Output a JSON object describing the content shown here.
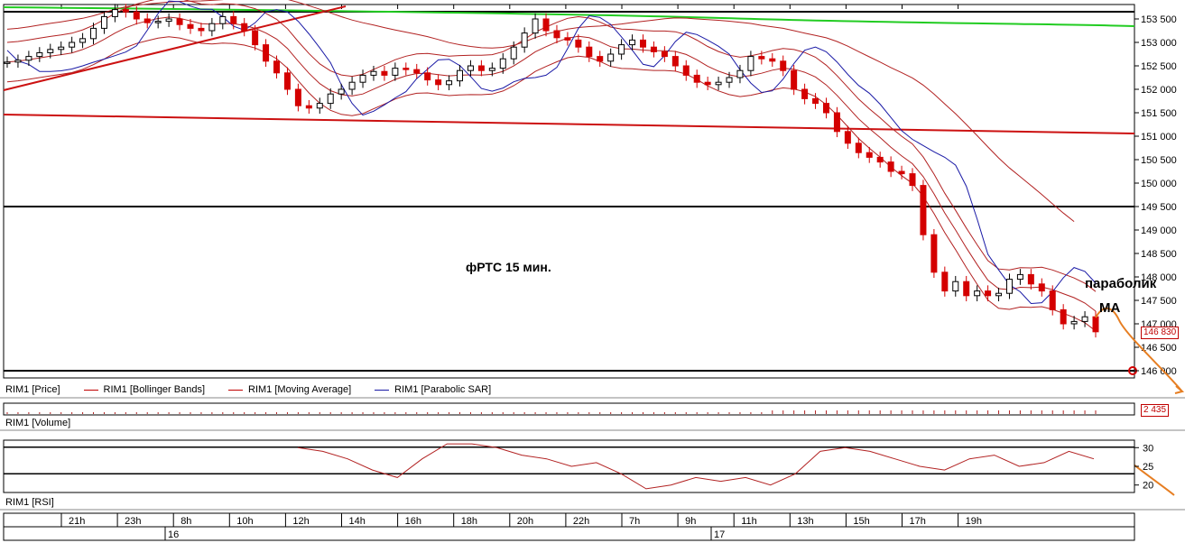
{
  "chart_data": {
    "type": "candlestick",
    "title": "фРТС   15 мин.",
    "ylim": [
      146000,
      153750
    ],
    "y_ticks": [
      "153 500",
      "153 000",
      "152 500",
      "152 000",
      "151 500",
      "151 000",
      "150 500",
      "150 000",
      "149 500",
      "149 000",
      "148 500",
      "148 000",
      "147 500",
      "147 000",
      "146 500",
      "146 000"
    ],
    "y_tick_values": [
      153500,
      153000,
      152500,
      152000,
      151500,
      151000,
      150500,
      150000,
      149500,
      149000,
      148500,
      148000,
      147500,
      147000,
      146500,
      146000
    ],
    "last_price": "146 830",
    "time_labels": [
      "21h",
      "23h",
      "8h",
      "10h",
      "12h",
      "14h",
      "16h",
      "18h",
      "20h",
      "22h",
      "7h",
      "9h",
      "11h",
      "13h",
      "15h",
      "17h",
      "19h"
    ],
    "date_labels": [
      "16",
      "17"
    ],
    "legend": [
      {
        "label": "RIM1 [Price]",
        "swatch": false
      },
      {
        "label": "RIM1 [Bollinger Bands]",
        "swatch": "bb"
      },
      {
        "label": "RIM1 [Moving Average]",
        "swatch": "ma"
      },
      {
        "label": "RIM1 [Parabolic SAR]",
        "swatch": "sar"
      }
    ],
    "volume_label": "RIM1 [Volume]",
    "volume_last": "2 435",
    "rsi_label": "RIM1 [RSI]",
    "rsi_ticks": [
      "30",
      "25",
      "20"
    ],
    "rsi_tick_values": [
      30,
      25,
      20
    ],
    "rsi_ylim": [
      18,
      32
    ],
    "annotations": [
      "параболик",
      "МА"
    ],
    "horizontal_levels": [
      153750,
      149500,
      146000
    ],
    "close_path": [
      152580,
      152620,
      152700,
      152780,
      152850,
      152900,
      153000,
      153080,
      153300,
      153550,
      153700,
      153650,
      153500,
      153420,
      153450,
      153500,
      153380,
      153300,
      153250,
      153400,
      153550,
      153400,
      153250,
      152950,
      152600,
      152350,
      152000,
      151650,
      151600,
      151700,
      151900,
      152000,
      152150,
      152300,
      152380,
      152300,
      152450,
      152420,
      152350,
      152200,
      152100,
      152180,
      152400,
      152500,
      152400,
      152450,
      152650,
      152900,
      153200,
      153500,
      153250,
      153100,
      153050,
      152900,
      152700,
      152600,
      152750,
      152950,
      153050,
      152900,
      152800,
      152700,
      152500,
      152300,
      152150,
      152100,
      152150,
      152250,
      152400,
      152700,
      152650,
      152600,
      152400,
      152000,
      151800,
      151700,
      151500,
      151100,
      150850,
      150650,
      150550,
      150450,
      150250,
      150200,
      149950,
      148900,
      148100,
      147700,
      147900,
      147600,
      147700,
      147600,
      147650,
      147950,
      148050,
      147850,
      147700,
      147300,
      147000,
      147050,
      147150,
      146830
    ],
    "rsi_path": [
      30,
      29,
      27,
      24,
      22,
      27,
      31,
      31,
      30,
      28,
      27,
      25,
      26,
      23,
      19,
      20,
      22,
      21,
      22,
      20,
      23,
      29,
      30,
      29,
      27,
      25,
      24,
      27,
      28,
      25,
      26,
      29,
      27
    ]
  }
}
